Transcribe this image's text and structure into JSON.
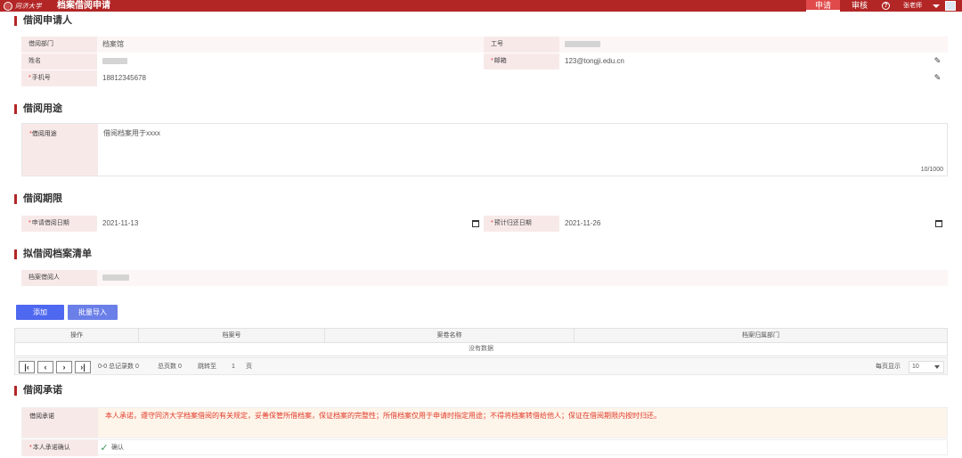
{
  "header": {
    "logo_text": "同济大学",
    "app_title": "档案借阅申请",
    "nav": {
      "apply": "申请",
      "review": "审核"
    },
    "help_icon": "help-icon",
    "user_name": "张老师",
    "colors": {
      "brand": "#b32626",
      "active_tab": "#e04a4a"
    }
  },
  "applicant": {
    "section_title": "借阅申请人",
    "dept_label": "借阅部门",
    "dept_value": "档案馆",
    "id_label": "工号",
    "name_label": "姓名",
    "email_label": "邮箱",
    "email_value": "123@tongji.edu.cn",
    "phone_label": "手机号",
    "phone_value": "18812345678"
  },
  "purpose": {
    "section_title": "借阅用途",
    "label": "借阅用途",
    "value": "借阅档案用于xxxx",
    "count": "10/1000"
  },
  "period": {
    "section_title": "借阅期限",
    "start_label": "申请借阅日期",
    "start_value": "2021-11-13",
    "end_label": "预计归还日期",
    "end_value": "2021-11-26"
  },
  "archive_list": {
    "section_title": "拟借阅档案清单",
    "borrower_label": "档案借阅人",
    "add_button": "添加",
    "import_button": "批量导入",
    "columns": [
      "操作",
      "档案号",
      "案卷名称",
      "档案归属部门"
    ],
    "empty_text": "没有数据",
    "pager": {
      "range": "0-0 总记录数 0",
      "total_pages": "总页数 0",
      "goto_label": "跳转至",
      "page_value": "1",
      "page_unit": "页",
      "per_page_label": "每页显示",
      "per_page_value": "10"
    }
  },
  "commitment": {
    "section_title": "借阅承诺",
    "label": "借阅承诺",
    "text": "本人承诺，遵守同济大学档案借阅的有关规定，妥善保管所借档案，保证档案的完整性；所借档案仅用于申请时指定用途；不得将档案转借给他人；保证在借阅期限内按时归还。",
    "confirm_label": "本人承诺确认",
    "confirm_text": "确认"
  }
}
